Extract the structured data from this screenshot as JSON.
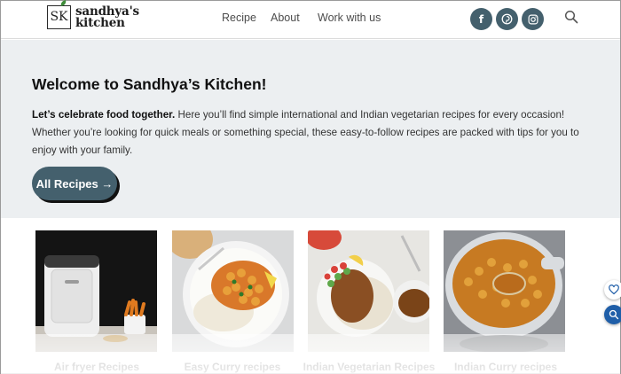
{
  "brand": {
    "logo_initials": "SK",
    "name_line1": "sandhya's",
    "name_line2": "kitchen"
  },
  "nav": {
    "items": [
      {
        "label": "Recipe"
      },
      {
        "label": "About"
      },
      {
        "label": "Work with us"
      }
    ]
  },
  "social": {
    "facebook": "f",
    "pinterest": "pinterest-icon",
    "instagram": "instagram-icon",
    "color": "#44606d"
  },
  "hero": {
    "title": "Welcome to Sandhya’s Kitchen!",
    "lead_bold": "Let’s celebrate food together.",
    "lead_rest": " Here you’ll find simple international and Indian vegetarian recipes for every occasion! Whether you’re looking for quick meals or something special, these easy-to-follow recipes are packed with tips for you to enjoy with your family.",
    "cta_label": "All Recipes →",
    "background": "#eceff1"
  },
  "cards": [
    {
      "label": "Air fryer Recipes"
    },
    {
      "label": "Easy Curry recipes"
    },
    {
      "label": "Indian Vegetarian Recipes"
    },
    {
      "label": "Indian Curry recipes"
    }
  ],
  "floating": {
    "heart": "heart-icon",
    "search": "search-icon"
  }
}
